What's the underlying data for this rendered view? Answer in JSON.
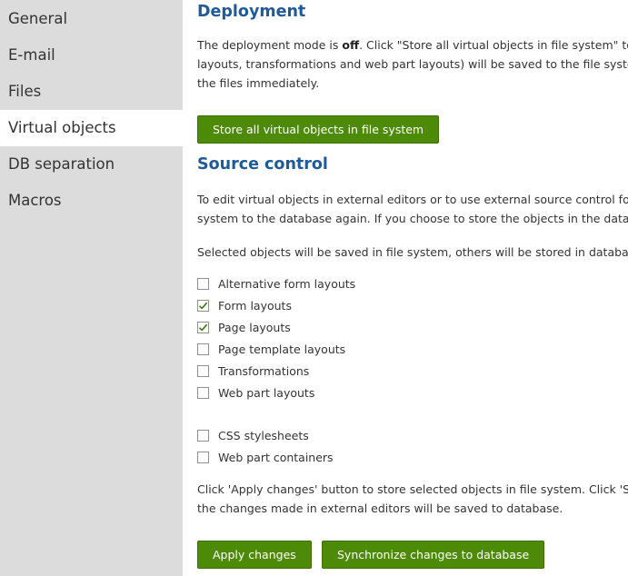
{
  "sidebar": {
    "items": [
      {
        "label": "General",
        "active": false
      },
      {
        "label": "E-mail",
        "active": false
      },
      {
        "label": "Files",
        "active": false
      },
      {
        "label": "Virtual objects",
        "active": true
      },
      {
        "label": "DB separation",
        "active": false
      },
      {
        "label": "Macros",
        "active": false
      }
    ]
  },
  "deployment": {
    "title": "Deployment",
    "text_line1_prefix": "The deployment mode is ",
    "text_line1_bold": "off",
    "text_line1_suffix": ". Click \"Store all virtual objects in file system\" to p",
    "text_line2": "layouts, transformations and web part layouts) will be saved to the file system",
    "text_line3": "the files immediately.",
    "store_button_label": "Store all virtual objects in file system"
  },
  "source_control": {
    "title": "Source control",
    "text_line1": "To edit virtual objects in external editors or to use external source control for t",
    "text_line2": "system to the database again. If you choose to store the objects in the databa",
    "selected_text": "Selected objects will be saved in file system, others will be stored in database:",
    "checkboxes_group1": [
      {
        "label": "Alternative form layouts",
        "checked": false
      },
      {
        "label": "Form layouts",
        "checked": true
      },
      {
        "label": "Page layouts",
        "checked": true
      },
      {
        "label": "Page template layouts",
        "checked": false
      },
      {
        "label": "Transformations",
        "checked": false
      },
      {
        "label": "Web part layouts",
        "checked": false
      }
    ],
    "checkboxes_group2": [
      {
        "label": "CSS stylesheets",
        "checked": false
      },
      {
        "label": "Web part containers",
        "checked": false
      }
    ],
    "apply_text_line1": "Click 'Apply changes' button to store selected objects in file system.  Click 'Syn",
    "apply_text_line2": "the changes made in external editors will be saved to database.",
    "apply_button_label": "Apply changes",
    "sync_button_label": "Synchronize changes to database"
  },
  "colors": {
    "sidebar_bg": "#dcdcdc",
    "heading": "#1f5b99",
    "button_bg": "#4d8a07",
    "checkmark": "#3a7a0a"
  }
}
